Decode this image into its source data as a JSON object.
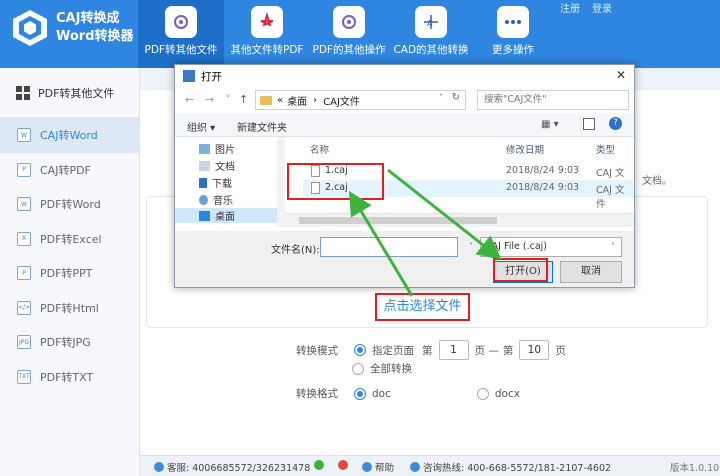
{
  "app": {
    "title_line1": "CAJ转换成",
    "title_line2": "Word转换器",
    "win_login": "注册",
    "win_register": "登录"
  },
  "nav": {
    "items": [
      {
        "label": "PDF转其他文件",
        "icon": "pdf-convert-icon"
      },
      {
        "label": "其他文件转PDF",
        "icon": "acrobat-icon"
      },
      {
        "label": "PDF的其他操作",
        "icon": "pdf-settings-icon"
      },
      {
        "label": "CAD的其他转换",
        "icon": "cad-icon"
      },
      {
        "label": "更多操作",
        "icon": "more-dots-icon"
      }
    ]
  },
  "sidebar": {
    "header": "PDF转其他文件",
    "items": [
      {
        "label": "CAJ转Word",
        "icon_text": "W"
      },
      {
        "label": "CAJ转PDF",
        "icon_text": "P"
      },
      {
        "label": "PDF转Word",
        "icon_text": "W"
      },
      {
        "label": "PDF转Excel",
        "icon_text": "X"
      },
      {
        "label": "PDF转PPT",
        "icon_text": "P"
      },
      {
        "label": "PDF转Html",
        "icon_text": "</>"
      },
      {
        "label": "PDF转JPG",
        "icon_text": "JPG"
      },
      {
        "label": "PDF转TXT",
        "icon_text": "TXT"
      }
    ]
  },
  "main": {
    "behind_text": "文档。",
    "choose_file": "点击选择文件",
    "mode_label": "转换模式",
    "mode_specified": "指定页面",
    "page_prefix": "第",
    "page_from": "1",
    "page_dash": "页 —",
    "page_prefix2": "第",
    "page_to": "10",
    "page_suffix": "页",
    "mode_all": "全部转换",
    "format_label": "转换格式",
    "format_doc": "doc",
    "format_docx": "docx"
  },
  "footer": {
    "qq": "客服: 4006685572/326231478",
    "help": "帮助",
    "hotline": "咨询热线: 400-668-5572/181-2107-4602",
    "version": "版本1.0.10"
  },
  "dialog": {
    "title": "打开",
    "close": "✕",
    "path_prefix": "«",
    "path_part1": "桌面",
    "path_sep": "›",
    "path_part2": "CAJ文件",
    "search_placeholder": "搜索\"CAJ文件\"",
    "organize": "组织 ▾",
    "new_folder": "新建文件夹",
    "tree": [
      "图片",
      "文档",
      "下载",
      "音乐",
      "桌面"
    ],
    "col_name": "名称",
    "col_date": "修改日期",
    "col_type": "类型",
    "files": [
      {
        "name": "1.caj",
        "date": "2018/8/24 9:03",
        "type": "CAJ 文件"
      },
      {
        "name": "2.caj",
        "date": "2018/8/24 9:03",
        "type": "CAJ 文件"
      }
    ],
    "filename_label": "文件名(N):",
    "filetype": "CAJ File (.caj)",
    "open_btn": "打开(O)",
    "cancel_btn": "取消"
  },
  "colors": {
    "header_blue": "#2f86e0",
    "annotation_red": "#e02020",
    "annotation_green": "#3cb43c"
  }
}
